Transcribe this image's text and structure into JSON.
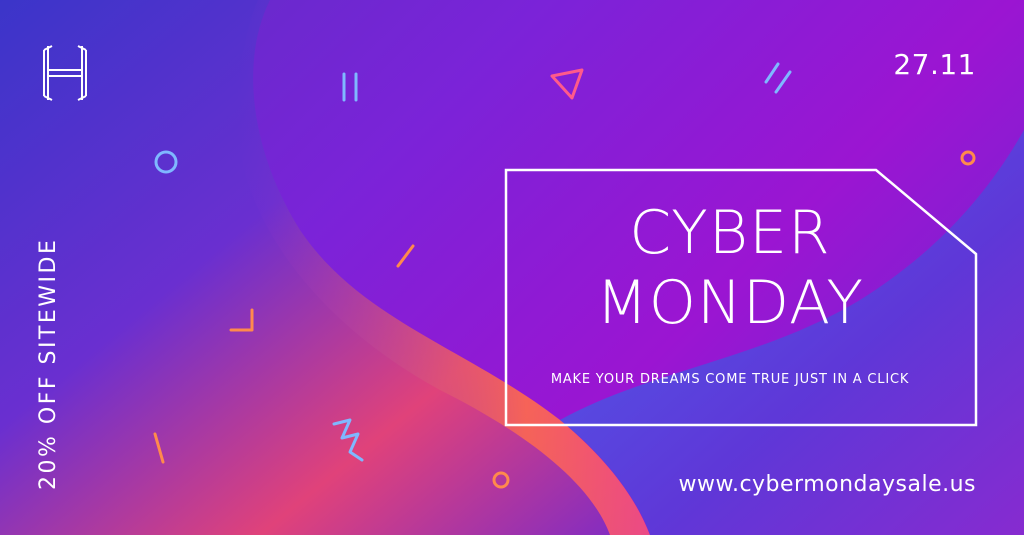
{
  "brand": {
    "logo_letter": "H"
  },
  "date": "27.11",
  "side_text": "20% OFF SITEWIDE",
  "headline": {
    "line1": "CYBER",
    "line2": "MONDAY"
  },
  "tagline": "MAKE YOUR DREAMS COME TRUE JUST IN A CLICK",
  "url": "www.cybermondaysale.us",
  "colors": {
    "accent_orange": "#ff8a4c",
    "accent_blue": "#7fb8ff",
    "accent_pink": "#ff5a8a",
    "frame": "#ffffff"
  }
}
